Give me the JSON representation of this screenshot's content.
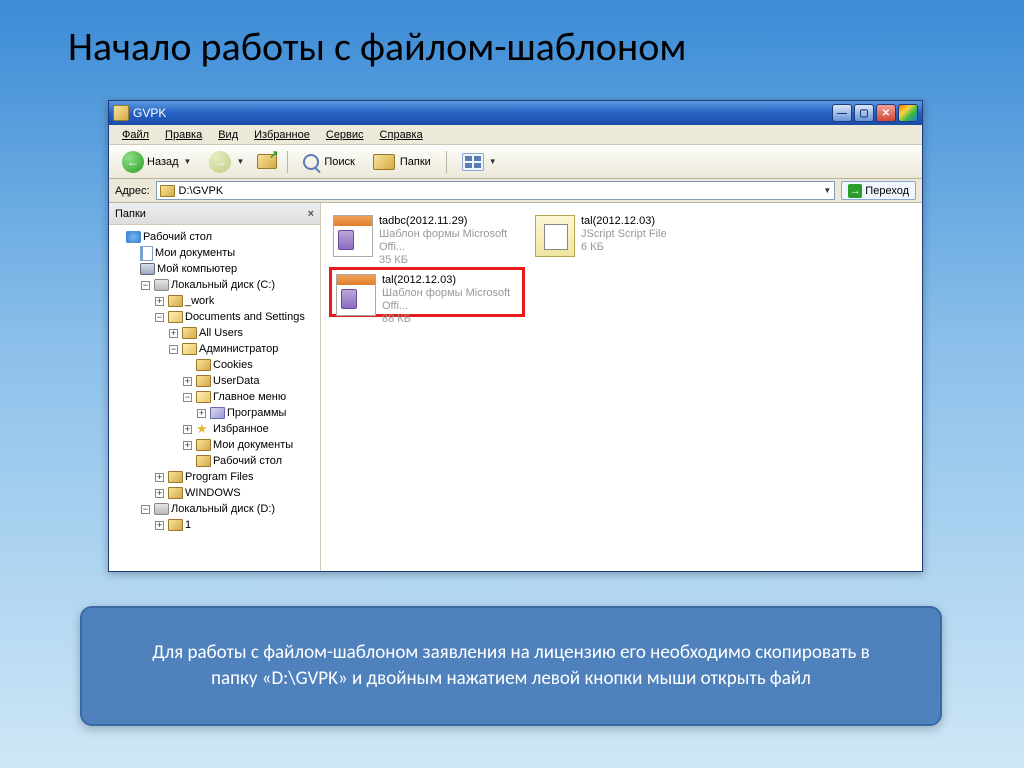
{
  "slide": {
    "title": "Начало работы с файлом-шаблоном"
  },
  "window": {
    "title": "GVPK",
    "menu": {
      "file": "Файл",
      "edit": "Правка",
      "view": "Вид",
      "fav": "Избранное",
      "tools": "Сервис",
      "help": "Справка"
    },
    "toolbar": {
      "back": "Назад",
      "search": "Поиск",
      "folders": "Папки"
    },
    "address": {
      "label": "Адрес:",
      "path": "D:\\GVPK",
      "go": "Переход"
    },
    "sidepane": {
      "title": "Папки"
    }
  },
  "tree": [
    {
      "d": 0,
      "pm": "",
      "ic": "desktop",
      "l": "Рабочий стол"
    },
    {
      "d": 1,
      "pm": "",
      "ic": "mydocs",
      "l": "Мои документы"
    },
    {
      "d": 1,
      "pm": "",
      "ic": "mycomp",
      "l": "Мой компьютер"
    },
    {
      "d": 2,
      "pm": "−",
      "ic": "disk",
      "l": "Локальный диск (C:)"
    },
    {
      "d": 3,
      "pm": "+",
      "ic": "folder",
      "l": "_work"
    },
    {
      "d": 3,
      "pm": "−",
      "ic": "folder-o",
      "l": "Documents and Settings"
    },
    {
      "d": 4,
      "pm": "+",
      "ic": "folder",
      "l": "All Users"
    },
    {
      "d": 4,
      "pm": "−",
      "ic": "folder-o",
      "l": "Администратор"
    },
    {
      "d": 5,
      "pm": "",
      "ic": "folder",
      "l": "Cookies"
    },
    {
      "d": 5,
      "pm": "+",
      "ic": "folder",
      "l": "UserData"
    },
    {
      "d": 5,
      "pm": "−",
      "ic": "folder-o",
      "l": "Главное меню"
    },
    {
      "d": 6,
      "pm": "+",
      "ic": "prog",
      "l": "Программы"
    },
    {
      "d": 5,
      "pm": "+",
      "ic": "star",
      "l": "Избранное"
    },
    {
      "d": 5,
      "pm": "+",
      "ic": "folder",
      "l": "Мои документы"
    },
    {
      "d": 5,
      "pm": "",
      "ic": "folder",
      "l": "Рабочий стол"
    },
    {
      "d": 3,
      "pm": "+",
      "ic": "folder",
      "l": "Program Files"
    },
    {
      "d": 3,
      "pm": "+",
      "ic": "folder",
      "l": "WINDOWS"
    },
    {
      "d": 2,
      "pm": "−",
      "ic": "disk",
      "l": "Локальный диск (D:)"
    },
    {
      "d": 3,
      "pm": "+",
      "ic": "folder",
      "l": "1"
    }
  ],
  "files": [
    {
      "name": "tadbc(2012.11.29)",
      "sub1": "Шаблон формы Microsoft Offi...",
      "sub2": "35 КБ",
      "type": "form",
      "hi": false
    },
    {
      "name": "tal(2012.12.03)",
      "sub1": "JScript Script File",
      "sub2": "6 КБ",
      "type": "script",
      "hi": false
    },
    {
      "name": "tal(2012.12.03)",
      "sub1": "Шаблон формы Microsoft Offi...",
      "sub2": "88 КБ",
      "type": "form",
      "hi": true
    }
  ],
  "callout": {
    "text": "Для работы с файлом-шаблоном заявления на лицензию его необходимо скопировать в папку «D:\\GVPK» и двойным нажатием левой кнопки мыши открыть файл"
  }
}
